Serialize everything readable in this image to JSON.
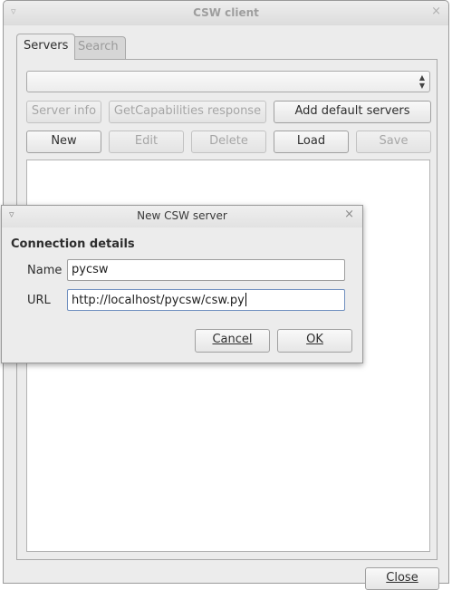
{
  "window": {
    "title": "CSW client",
    "menu_icon": "▿",
    "close_icon": "×"
  },
  "tabs": [
    {
      "label": "Servers",
      "active": true
    },
    {
      "label": "Search",
      "active": false
    }
  ],
  "servers": {
    "selected_server": "",
    "buttons_row1": [
      {
        "label": "Server info",
        "enabled": false
      },
      {
        "label": "GetCapabilities response",
        "enabled": false
      },
      {
        "label": "Add default servers",
        "enabled": true
      }
    ],
    "buttons_row2": [
      {
        "label": "New",
        "enabled": true
      },
      {
        "label": "Edit",
        "enabled": false
      },
      {
        "label": "Delete",
        "enabled": false
      },
      {
        "label": "Load",
        "enabled": true
      },
      {
        "label": "Save",
        "enabled": false
      }
    ],
    "close_label": "Close"
  },
  "dialog": {
    "title": "New CSW server",
    "menu_icon": "▿",
    "close_icon": "×",
    "section_title": "Connection details",
    "name_label": "Name",
    "name_value": "pycsw",
    "url_label": "URL",
    "url_value": "http://localhost/pycsw/csw.py",
    "cancel_label": "Cancel",
    "ok_label": "OK"
  }
}
